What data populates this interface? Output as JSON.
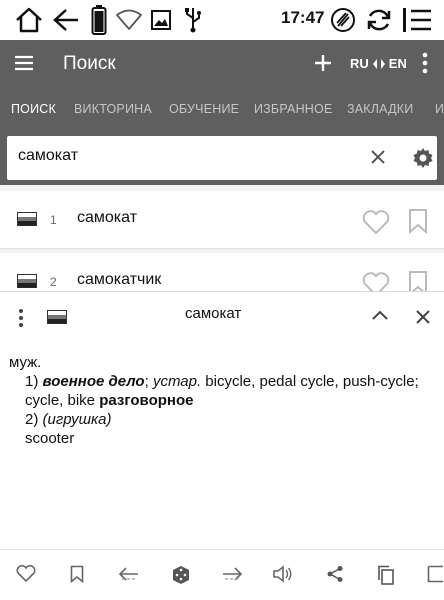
{
  "status_bar": {
    "time": "17:47",
    "icons": [
      "home-icon",
      "back-arrow-icon",
      "battery-icon",
      "wifi-icon",
      "image-icon",
      "usb-icon",
      "clean-icon",
      "refresh-icon",
      "list-menu-icon"
    ]
  },
  "toolbar": {
    "title": "Поиск",
    "lang_from": "RU",
    "lang_to": "EN"
  },
  "tabs": [
    "ПОИСК",
    "ВИКТОРИНА",
    "ОБУЧЕНИЕ",
    "ИЗБРАННОЕ",
    "ЗАКЛАДКИ",
    "И"
  ],
  "search": {
    "value": "самокат",
    "placeholder": ""
  },
  "results": [
    {
      "num": "1",
      "word": "самокат"
    },
    {
      "num": "2",
      "word": "самокатчик"
    }
  ],
  "definition": {
    "title": "самокат",
    "gender": "муж.",
    "sense1_num": "1)",
    "sense1_domain": "военное дело",
    "sense1_sep": ";",
    "sense1_register": "устар.",
    "sense1_text": "bicycle, pedal cycle, push-cycle; cycle, bike",
    "sense1_label": "разговорное",
    "sense2_num": "2)",
    "sense2_note": "(игрушка)",
    "sense2_text": "scooter"
  },
  "bottom_bar": {
    "icons": [
      "heart-icon",
      "bookmark-icon",
      "prev-arrow-icon",
      "dice-icon",
      "next-arrow-icon",
      "speaker-icon",
      "share-icon",
      "copy-icon",
      "page-icon"
    ]
  },
  "colors": {
    "toolbar_bg": "#5f5f5f",
    "tab_active": "#ffffff",
    "tab_inactive": "#c6c6c6"
  }
}
